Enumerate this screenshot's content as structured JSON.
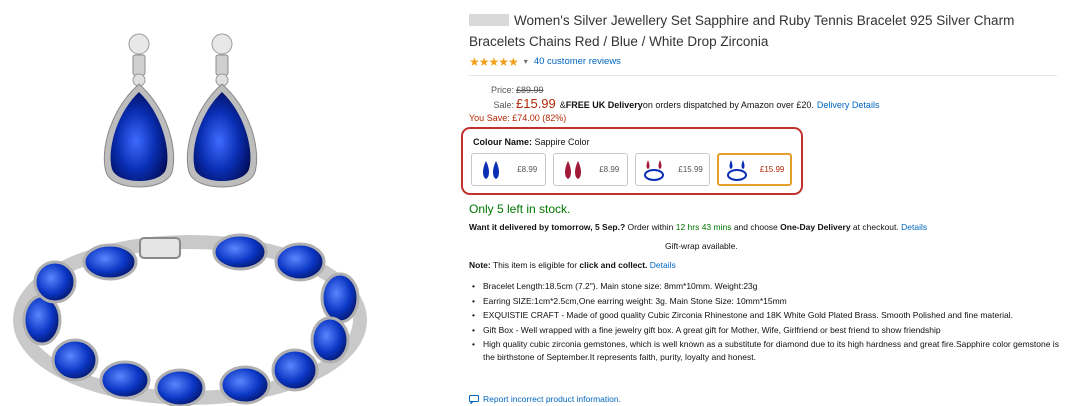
{
  "title": "Women's Silver Jewellery Set Sapphire and Ruby Tennis Bracelet 925 Silver Charm Bracelets Chains Red / Blue / White Drop Zirconia",
  "rating": {
    "stars": "★★★★★",
    "caret": "▾",
    "reviews_label": "40 customer reviews"
  },
  "price": {
    "price_label": "Price:",
    "list_price": "£89.99",
    "sale_label": "Sale:",
    "sale_price": "£15.99",
    "delivery_prefix": "& ",
    "delivery_bold": "FREE UK Delivery",
    "delivery_rest": " on orders dispatched by Amazon over £20.",
    "delivery_link": "Delivery Details",
    "you_save": "You Save: £74.00 (82%)"
  },
  "variants": {
    "label": "Colour Name:",
    "selected_name": "Sappire Color",
    "options": [
      {
        "price": "£8.99",
        "selected": false
      },
      {
        "price": "£8.99",
        "selected": false
      },
      {
        "price": "£15.99",
        "selected": false
      },
      {
        "price": "£15.99",
        "selected": true
      }
    ]
  },
  "stock": "Only 5 left in stock.",
  "delivery_line": {
    "bold": "Want it delivered by tomorrow, 5 Sep.?",
    "mid": " Order within ",
    "time": "12 hrs 43 mins",
    "mid2": " and choose ",
    "bold2": "One-Day Delivery",
    "end": " at checkout.",
    "link": "Details"
  },
  "gift_wrap": "Gift-wrap available.",
  "note": {
    "bold": "Note:",
    "text": " This item is eligible for ",
    "bold2": "click and collect.",
    "link": "Details"
  },
  "bullets": [
    "Bracelet Length:18.5cm (7.2\"). Main stone size: 8mm*10mm. Weight:23g",
    "Earring SIZE:1cm*2.5cm,One earring weight: 3g. Main Stone Size: 10mm*15mm",
    "EXQUISTIE CRAFT - Made of good quality Cubic Zirconia Rhinestone and 18K White Gold Plated Brass. Smooth Polished and fine material.",
    "Gift Box - Well wrapped with a fine jewelry gift box. A great gift for Mother, Wife, Girlfriend or best friend to show friendship",
    "High quality cubic zirconia gemstones, which is well known as a substitute for diamond due to its high hardness and great fire.Sapphire color gemstone is the birthstone of September.It represents faith, purity, loyalty and honest."
  ],
  "report_link": "Report incorrect product information.",
  "colors": {
    "sapphire": "#0a2fb4",
    "ruby": "#a21a3a",
    "link": "#0066c0",
    "price_red": "#b12704",
    "stock_green": "#007600",
    "highlight": "#c0312b"
  }
}
